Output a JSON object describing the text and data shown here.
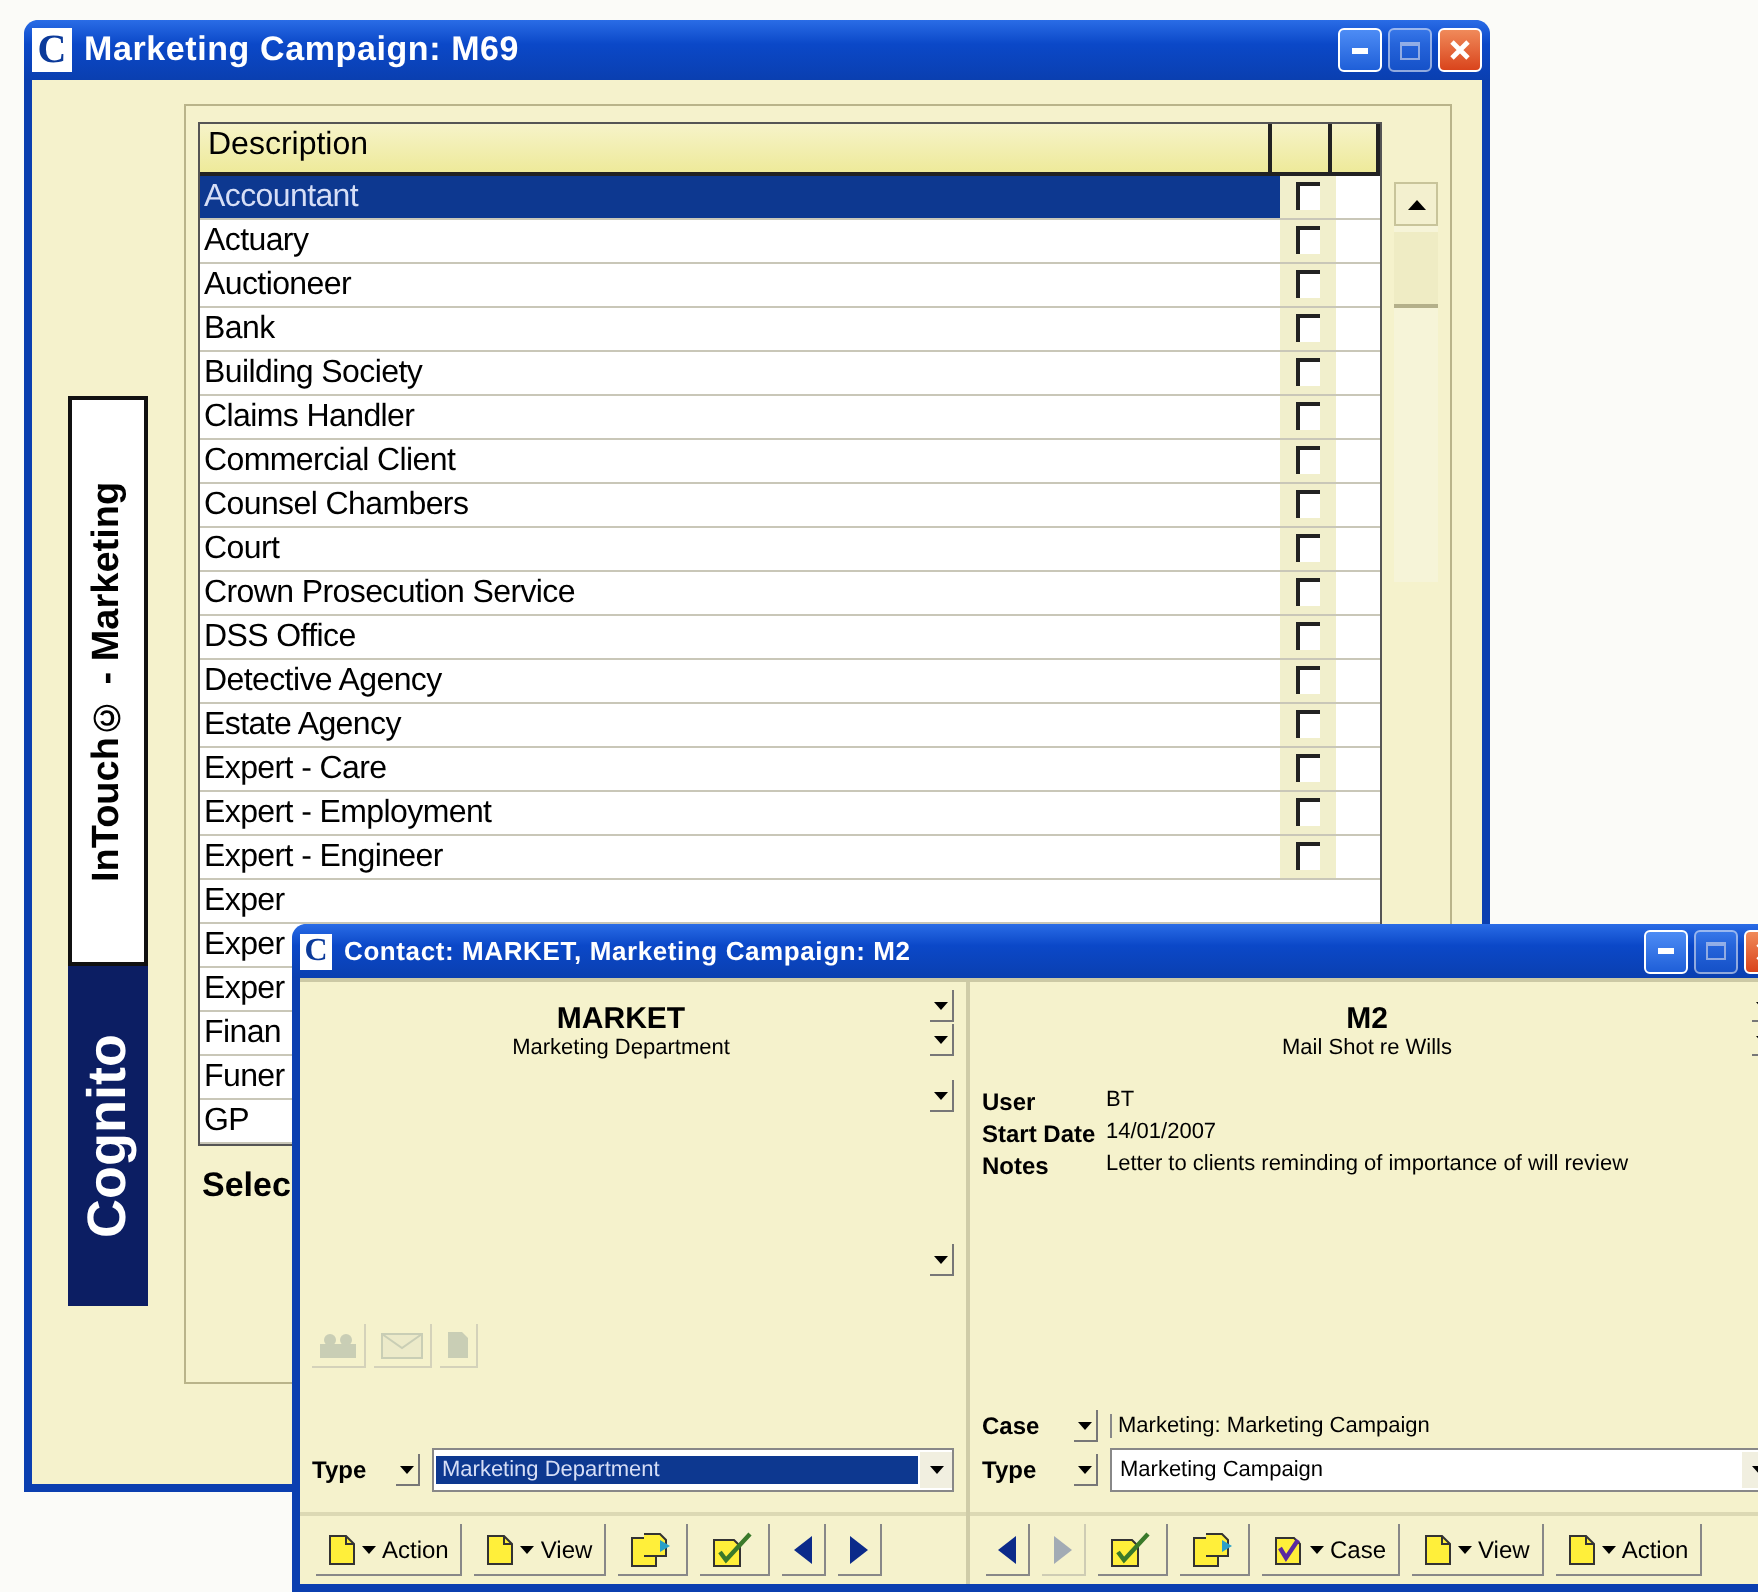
{
  "back_window": {
    "logo": "C",
    "title": "Marketing Campaign: M69",
    "sidebar": {
      "product": "InTouch© - Marketing",
      "brand": "Cognito"
    },
    "list": {
      "columns": [
        "Description"
      ],
      "rows": [
        {
          "description": "Accountant",
          "selected": true,
          "checked": false
        },
        {
          "description": "Actuary",
          "selected": false,
          "checked": false
        },
        {
          "description": "Auctioneer",
          "selected": false,
          "checked": false
        },
        {
          "description": "Bank",
          "selected": false,
          "checked": false
        },
        {
          "description": "Building Society",
          "selected": false,
          "checked": false
        },
        {
          "description": "Claims Handler",
          "selected": false,
          "checked": false
        },
        {
          "description": "Commercial Client",
          "selected": false,
          "checked": false
        },
        {
          "description": "Counsel Chambers",
          "selected": false,
          "checked": false
        },
        {
          "description": "Court",
          "selected": false,
          "checked": false
        },
        {
          "description": "Crown Prosecution Service",
          "selected": false,
          "checked": false
        },
        {
          "description": "DSS Office",
          "selected": false,
          "checked": false
        },
        {
          "description": "Detective Agency",
          "selected": false,
          "checked": false
        },
        {
          "description": "Estate Agency",
          "selected": false,
          "checked": false
        },
        {
          "description": "Expert - Care",
          "selected": false,
          "checked": false
        },
        {
          "description": "Expert - Employment",
          "selected": false,
          "checked": false
        },
        {
          "description": "Expert - Engineer",
          "selected": false,
          "checked": false
        },
        {
          "description": "Exper",
          "selected": false
        },
        {
          "description": "Exper",
          "selected": false
        },
        {
          "description": "Exper",
          "selected": false
        },
        {
          "description": "Finan",
          "selected": false
        },
        {
          "description": "Funer",
          "selected": false
        },
        {
          "description": "GP",
          "selected": false
        }
      ]
    },
    "footer_label": "Selec"
  },
  "front_window": {
    "logo": "C",
    "title": "Contact: MARKET, Marketing Campaign: M2",
    "left": {
      "heading": "MARKET",
      "subheading": "Marketing Department",
      "tools": [
        {
          "kind": "contacts",
          "disabled": true
        },
        {
          "kind": "mail",
          "disabled": true
        },
        {
          "kind": "note",
          "disabled": true
        }
      ],
      "type_field": {
        "label": "Type",
        "value": "Marketing Department",
        "selected": true
      },
      "toolbar": [
        {
          "kind": "menu",
          "label": "Action"
        },
        {
          "kind": "menu",
          "label": "View"
        },
        {
          "kind": "doc-add"
        },
        {
          "kind": "doc-check"
        },
        {
          "kind": "prev",
          "disabled": false
        },
        {
          "kind": "next",
          "disabled": false
        }
      ]
    },
    "right": {
      "heading": "M2",
      "subheading": "Mail Shot re Wills",
      "fields": [
        {
          "label": "User",
          "value": "BT"
        },
        {
          "label": "Start Date",
          "value": "14/01/2007"
        },
        {
          "label": "Notes",
          "value": "Letter to clients reminding of importance of will review"
        }
      ],
      "case_field": {
        "label": "Case",
        "value": "Marketing: Marketing Campaign"
      },
      "type_field": {
        "label": "Type",
        "value": "Marketing Campaign",
        "selected": false
      },
      "toolbar": [
        {
          "kind": "prev",
          "disabled": false
        },
        {
          "kind": "next",
          "disabled": true
        },
        {
          "kind": "doc-check"
        },
        {
          "kind": "doc-add"
        },
        {
          "kind": "case-menu",
          "label": "Case"
        },
        {
          "kind": "menu",
          "label": "View"
        },
        {
          "kind": "menu",
          "label": "Action"
        }
      ]
    }
  }
}
